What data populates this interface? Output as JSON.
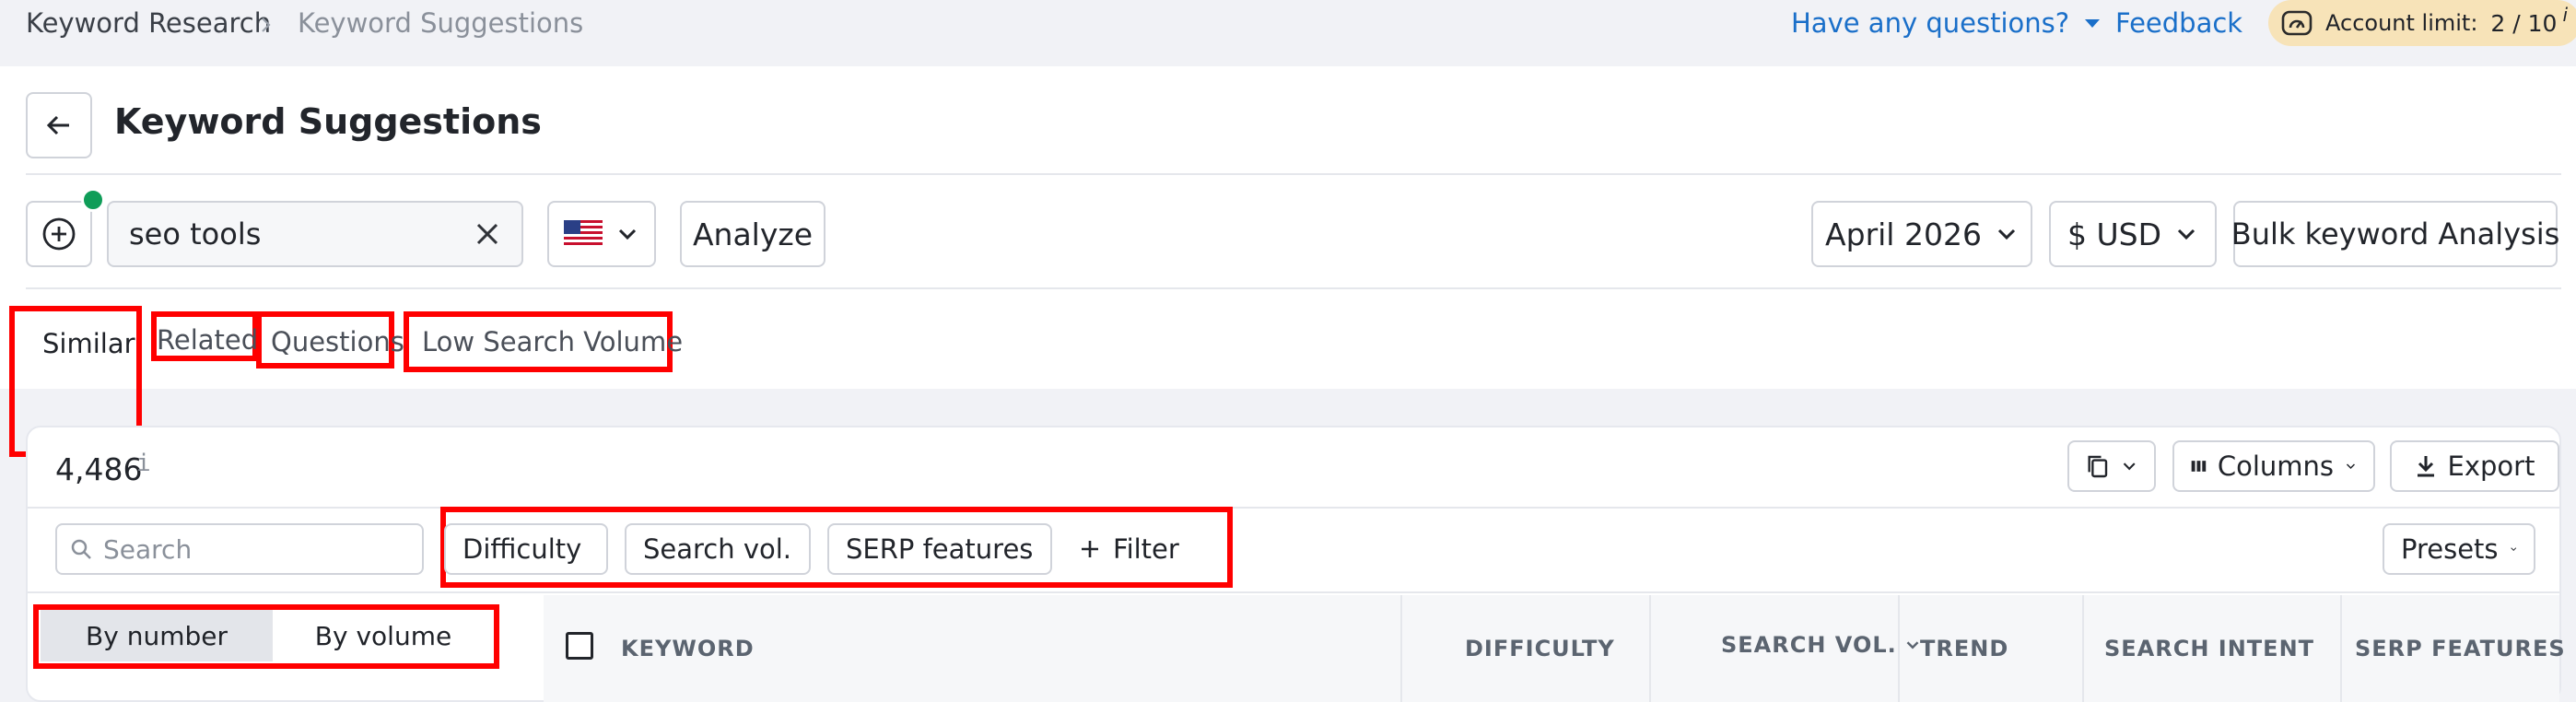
{
  "breadcrumb": {
    "root": "Keyword Research",
    "current": "Keyword Suggestions"
  },
  "topbar": {
    "questions_label": "Have any questions?",
    "feedback_label": "Feedback",
    "account_limit_label": "Account limit:",
    "account_limit_value": "2 / 10",
    "info_mark": "i"
  },
  "page": {
    "title": "Keyword Suggestions"
  },
  "search": {
    "keyword_value": "seo tools",
    "analyze_label": "Analyze"
  },
  "controls": {
    "date_label": "April 2026",
    "currency_label": "$ USD",
    "bulk_label": "Bulk keyword Analysis"
  },
  "tabs": [
    {
      "label": "Similar",
      "active": true
    },
    {
      "label": "Related",
      "active": false
    },
    {
      "label": "Questions",
      "active": false
    },
    {
      "label": "Low Search Volume",
      "active": false
    }
  ],
  "results": {
    "count": "4,486",
    "count_info": "i",
    "columns_label": "Columns",
    "export_label": "Export"
  },
  "filters": {
    "search_placeholder": "Search",
    "difficulty_label": "Difficulty",
    "search_vol_label": "Search vol.",
    "serp_label": "SERP features",
    "filter_label": "Filter",
    "presets_label": "Presets"
  },
  "grouping": {
    "by_number": "By number",
    "by_volume": "By volume"
  },
  "table": {
    "headers": [
      "KEYWORD",
      "DIFFICULTY",
      "SEARCH VOL.",
      "TREND",
      "SEARCH INTENT",
      "SERP FEATURES"
    ]
  },
  "colors": {
    "accent_blue": "#1a6fc9",
    "highlight_red": "#ff0000",
    "status_green": "#0f9d58",
    "limit_badge": "#f7e3b8"
  }
}
